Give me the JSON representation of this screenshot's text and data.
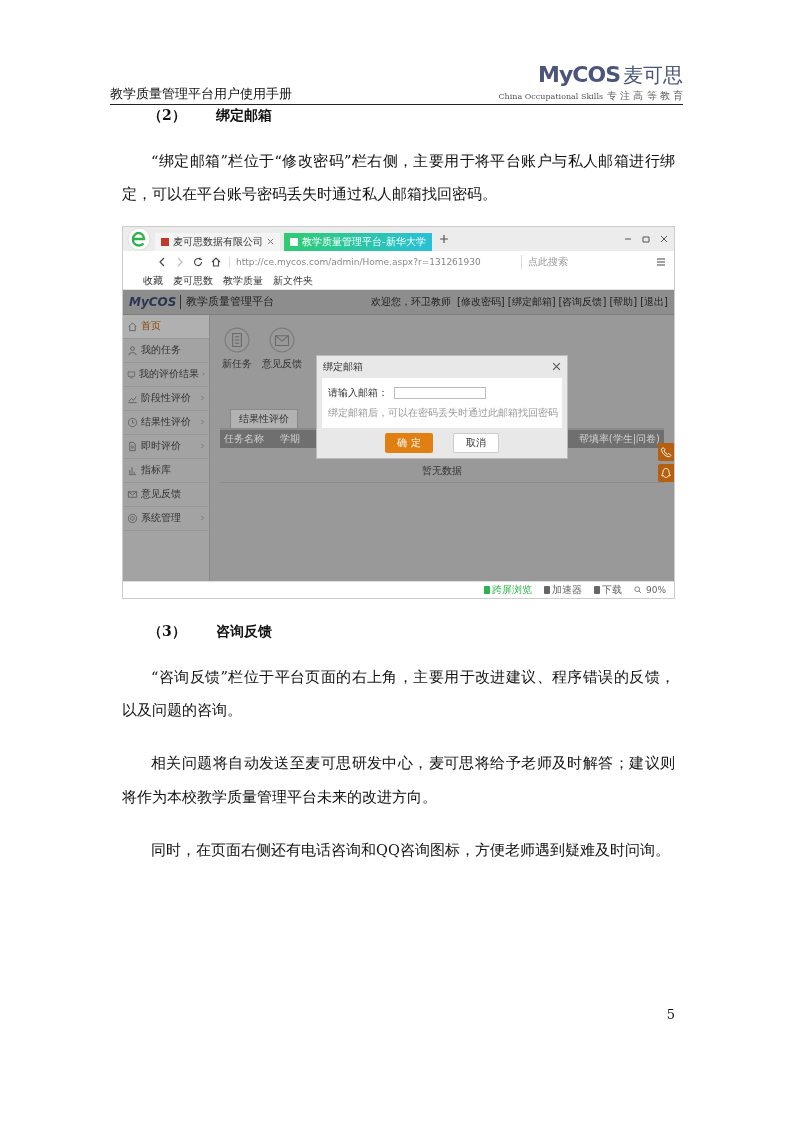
{
  "header": {
    "title": "教学质量管理平台用户使用手册",
    "logo": {
      "brand": "MyCOS",
      "name": "麦可思",
      "tagline_en": "China Occupational Skills",
      "tagline_cn": "专 注 高 等 教 育"
    }
  },
  "section_2": {
    "number": "（2）",
    "title": "绑定邮箱",
    "paragraphs": [
      "“绑定邮箱”栏位于“修改密码”栏右侧，主要用于将平台账户与私人邮箱进行绑定，可以在平台账号密码丢失时通过私人邮箱找回密码。"
    ]
  },
  "screenshot": {
    "browser": {
      "tabs": [
        {
          "title": "麦可思数据有限公司",
          "selected": false
        },
        {
          "title": "教学质量管理平台-新华大学",
          "selected": true
        }
      ],
      "address": "http://ce.mycos.com/admin/Home.aspx?r=131261930",
      "search_placeholder": "点此搜索",
      "bookmarks": [
        "收藏",
        "麦可思数",
        "教学质量",
        "新文件夹"
      ]
    },
    "app": {
      "brand": "MyCOS",
      "title": "教学质量管理平台",
      "user": "欢迎您，环卫教师",
      "links": [
        "[修改密码]",
        "[绑定邮箱]",
        "[咨询反馈]",
        "[帮助]",
        "[退出]"
      ],
      "sidebar": [
        {
          "label": "首页",
          "selected": true,
          "has_submenu": false
        },
        {
          "label": "我的任务",
          "selected": false,
          "has_submenu": false
        },
        {
          "label": "我的评价结果",
          "selected": false,
          "has_submenu": true
        },
        {
          "label": "阶段性评价",
          "selected": false,
          "has_submenu": true
        },
        {
          "label": "结果性评价",
          "selected": false,
          "has_submenu": true
        },
        {
          "label": "即时评价",
          "selected": false,
          "has_submenu": true
        },
        {
          "label": "指标库",
          "selected": false,
          "has_submenu": false
        },
        {
          "label": "意见反馈",
          "selected": false,
          "has_submenu": false
        },
        {
          "label": "系统管理",
          "selected": false,
          "has_submenu": true
        }
      ],
      "shortcuts": [
        "新任务",
        "意见反馈"
      ],
      "tabs": [
        {
          "label": "结果性评价",
          "selected": true
        }
      ],
      "columns": [
        "任务名称",
        "学期",
        "帮填率(学生|问卷)"
      ],
      "empty": "暂无数据",
      "dialog": {
        "title": "绑定邮箱",
        "label": "请输入邮箱：",
        "hint": "绑定邮箱后，可以在密码丢失时通过此邮箱找回密码",
        "ok": "确 定",
        "cancel": "取消"
      }
    },
    "status_bar": {
      "items": [
        {
          "label": "跨屏浏览",
          "color": "#2bb24c"
        },
        {
          "label": "加速器",
          "color": "#666666"
        },
        {
          "label": "下载",
          "color": "#666666"
        }
      ],
      "zoom": "90%"
    }
  },
  "section_3": {
    "number": "（3）",
    "title": "咨询反馈",
    "paragraphs": [
      "“咨询反馈”栏位于平台页面的右上角，主要用于改进建议、程序错误的反馈，以及问题的咨询。",
      "相关问题将自动发送至麦可思研发中心，麦可思将给予老师及时解答；建议则将作为本校教学质量管理平台未来的改进方向。",
      "同时，在页面右侧还有电话咨询和QQ咨询图标，方便老师遇到疑难及时问询。"
    ]
  },
  "page_number": "5"
}
